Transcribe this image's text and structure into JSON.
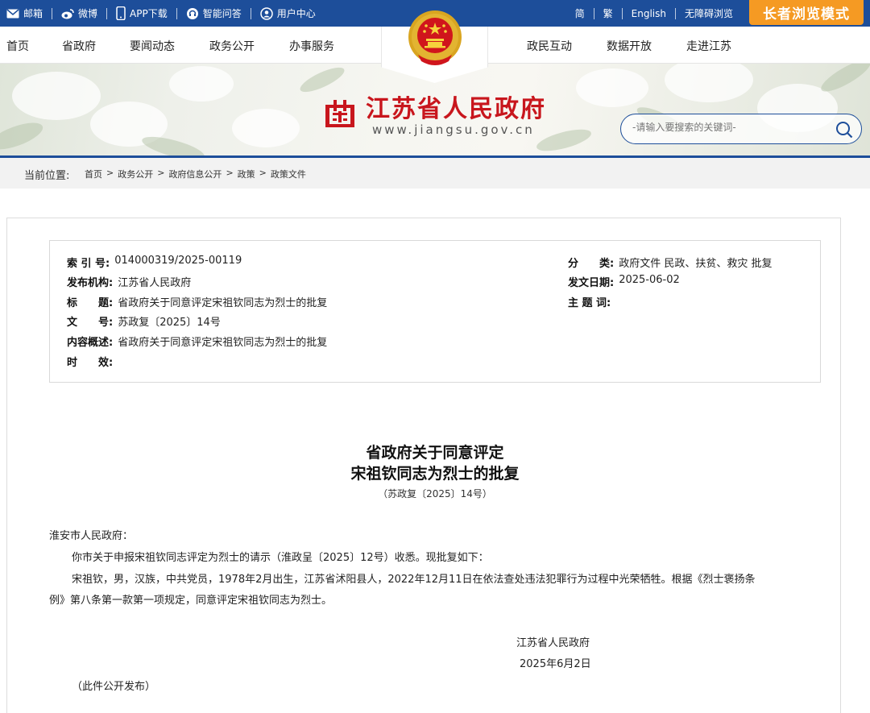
{
  "topbar": {
    "links": [
      {
        "label": "邮箱",
        "icon": "mail-icon"
      },
      {
        "label": "微博",
        "icon": "weibo-icon"
      },
      {
        "label": "APP下载",
        "icon": "phone-icon"
      },
      {
        "label": "智能问答",
        "icon": "chat-icon"
      },
      {
        "label": "用户中心",
        "icon": "user-icon"
      }
    ],
    "lang": {
      "simplified": "简",
      "traditional": "繁",
      "english": "English",
      "accessible": "无障碍浏览"
    },
    "elder_mode": "长者浏览模式"
  },
  "nav": {
    "items": [
      "首页",
      "省政府",
      "要闻动态",
      "政务公开",
      "办事服务",
      "政民互动",
      "数据开放",
      "走进江苏"
    ]
  },
  "header": {
    "title": "江苏省人民政府",
    "domain": "www.jiangsu.gov.cn",
    "search_placeholder": "-请输入要搜索的关键词-"
  },
  "breadcrumb": {
    "label": "当前位置:",
    "items": [
      "首页",
      "政务公开",
      "政府信息公开",
      "政策",
      "政策文件"
    ]
  },
  "meta": {
    "index_key": "索 引 号:",
    "index_val": "014000319/2025-00119",
    "org_key": "发布机构:",
    "org_val": "江苏省人民政府",
    "title_key": "标　　题:",
    "title_val": "省政府关于同意评定宋祖钦同志为烈士的批复",
    "docno_key": "文　　号:",
    "docno_val": "苏政复〔2025〕14号",
    "summary_key": "内容概述:",
    "summary_val": "省政府关于同意评定宋祖钦同志为烈士的批复",
    "validity_key": "时　　效:",
    "validity_val": "",
    "category_key": "分　　类:",
    "category_val": "政府文件 民政、扶贫、救灾 批复",
    "date_key": "发文日期:",
    "date_val": "2025-06-02",
    "subject_key": "主 题 词:",
    "subject_val": ""
  },
  "doc": {
    "title_line1": "省政府关于同意评定",
    "title_line2": "宋祖钦同志为烈士的批复",
    "number": "（苏政复〔2025〕14号）",
    "addressee": "淮安市人民政府：",
    "para1": "你市关于申报宋祖钦同志评定为烈士的请示（淮政呈〔2025〕12号）收悉。现批复如下：",
    "para2_line1": "宋祖钦，男，汉族，中共党员，1978年2月出生，江苏省沭阳县人，2022年12月11日在依法查处违法犯罪行为过程中光荣牺牲。根据《烈士褒扬条",
    "para2_line2": "例》第八条第一款第一项规定，同意评定宋祖钦同志为烈士。",
    "signer": "江苏省人民政府",
    "sign_date": "2025年6月2日",
    "note": "（此件公开发布）"
  },
  "colors": {
    "primary": "#1d4e9a",
    "accent": "#f59a23",
    "title_red": "#c8161d"
  }
}
